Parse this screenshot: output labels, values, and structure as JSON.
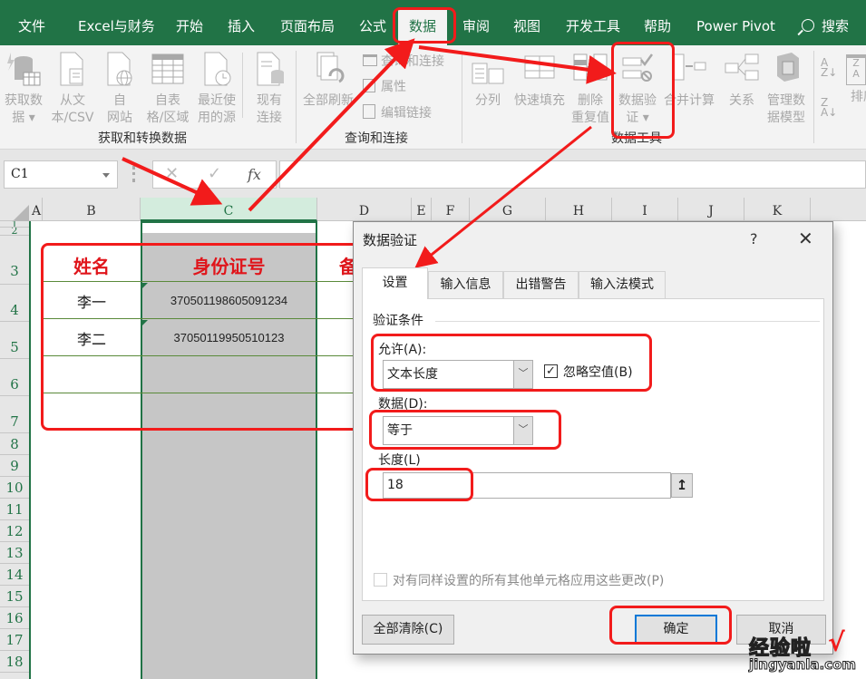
{
  "ribbon_tabs": [
    {
      "label": "文件"
    },
    {
      "label": "Excel与财务"
    },
    {
      "label": "开始"
    },
    {
      "label": "插入"
    },
    {
      "label": "页面布局"
    },
    {
      "label": "公式"
    },
    {
      "label": "数据",
      "active": true
    },
    {
      "label": "审阅"
    },
    {
      "label": "视图"
    },
    {
      "label": "开发工具"
    },
    {
      "label": "帮助"
    },
    {
      "label": "Power Pivot"
    }
  ],
  "search": {
    "label": "搜索"
  },
  "ribbon": {
    "groups": {
      "get_transform": {
        "label": "获取和转换数据",
        "buttons": [
          {
            "line1": "获取数",
            "line2": "据 ▾",
            "icon": "database-icon"
          },
          {
            "line1": "从文",
            "line2": "本/CSV",
            "icon": "text-file-icon"
          },
          {
            "line1": "自",
            "line2": "网站",
            "icon": "web-icon"
          },
          {
            "line1": "自表",
            "line2": "格/区域",
            "icon": "table-icon"
          },
          {
            "line1": "最近使",
            "line2": "用的源",
            "icon": "recent-sources-icon"
          },
          {
            "line1": "现有",
            "line2": "连接",
            "icon": "existing-connections-icon"
          }
        ]
      },
      "queries": {
        "label": "查询和连接",
        "refresh_all": "全部刷新",
        "small": [
          "查询和连接",
          "属性",
          "编辑链接"
        ]
      },
      "data_tools": {
        "label": "数据工具",
        "buttons": [
          {
            "line1": "分列",
            "line2": ""
          },
          {
            "line1": "快速填充",
            "line2": ""
          },
          {
            "line1": "删除",
            "line2": "重复值"
          },
          {
            "line1": "数据验",
            "line2": "证 ▾"
          },
          {
            "line1": "合并计算",
            "line2": ""
          },
          {
            "line1": "关系",
            "line2": ""
          },
          {
            "line1": "管理数",
            "line2": "据模型"
          }
        ]
      },
      "sort": {
        "az": "A↓Z",
        "za": "Z↓A",
        "sort_label": "排序"
      }
    }
  },
  "formula_bar": {
    "name_box": "C1",
    "cancel": "✕",
    "enter": "✓",
    "fx": "fx",
    "formula": ""
  },
  "columns": [
    "A",
    "B",
    "C",
    "D",
    "E",
    "F",
    "G",
    "H",
    "I",
    "J",
    "K"
  ],
  "selected_column": "C",
  "rows": [
    "1",
    "2",
    "3",
    "4",
    "5",
    "6",
    "7",
    "8",
    "9",
    "10",
    "11",
    "12",
    "13",
    "14",
    "15",
    "16",
    "17",
    "18"
  ],
  "table": {
    "headers": [
      "姓名",
      "身份证号",
      "备"
    ],
    "rows": [
      {
        "name": "李一",
        "id": "370501198605091234"
      },
      {
        "name": "李二",
        "id": "37050119950510123"
      },
      {
        "name": "",
        "id": ""
      },
      {
        "name": "",
        "id": ""
      }
    ]
  },
  "dialog": {
    "title": "数据验证",
    "help": "?",
    "close": "✕",
    "tabs": [
      {
        "label": "设置",
        "active": true
      },
      {
        "label": "输入信息"
      },
      {
        "label": "出错警告"
      },
      {
        "label": "输入法模式"
      }
    ],
    "section_title": "验证条件",
    "allow_label": "允许(A):",
    "allow_value": "文本长度",
    "ignore_blank_label": "忽略空值(B)",
    "ignore_blank_checked": true,
    "data_label": "数据(D):",
    "data_value": "等于",
    "length_label": "长度(L)",
    "length_value": "18",
    "apply_all_label": "对有同样设置的所有其他单元格应用这些更改(P)",
    "apply_all_checked": false,
    "clear_all": "全部清除(C)",
    "ok": "确定",
    "cancel": "取消"
  },
  "watermark": {
    "text": "经验啦",
    "check": "√",
    "url": "jingyanla.com"
  },
  "colors": {
    "excel_green": "#217346",
    "annotation_red": "#f21b1b",
    "header_red": "#e0151b",
    "selection_gray": "#c6c6c6"
  }
}
